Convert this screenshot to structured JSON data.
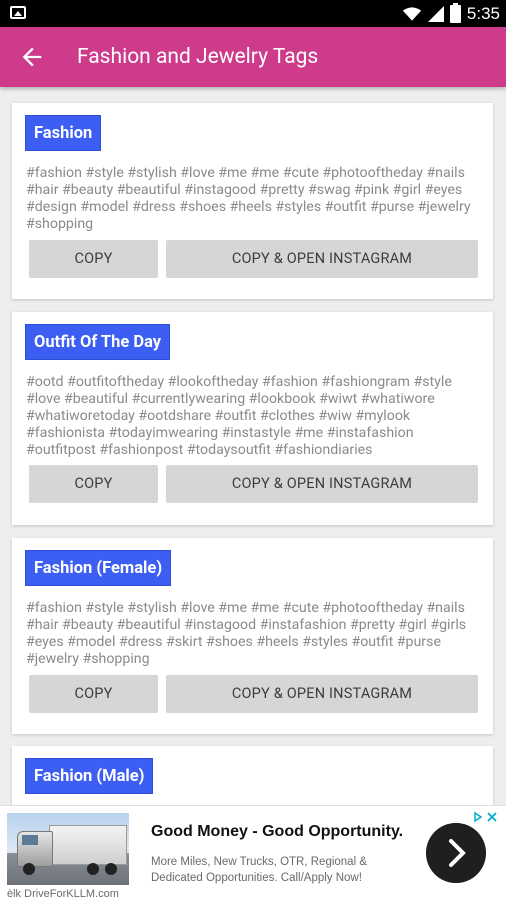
{
  "status_bar": {
    "time": "5:35"
  },
  "app_bar": {
    "title": "Fashion and Jewelry Tags"
  },
  "cards": [
    {
      "title": "Fashion",
      "tags": "#fashion #style #stylish #love #me #me #cute #photooftheday #nails #hair #beauty #beautiful #instagood #pretty #swag #pink #girl #eyes #design #model #dress #shoes #heels #styles #outfit #purse #jewelry #shopping",
      "copy_label": "COPY",
      "open_label": "COPY & OPEN INSTAGRAM"
    },
    {
      "title": "Outfit Of The Day",
      "tags": "#ootd #outfitoftheday #lookoftheday #fashion #fashiongram #style #love #beautiful #currentlywearing #lookbook #wiwt #whatiwore #whatiworetoday #ootdshare #outfit #clothes #wiw #mylook #fashionista #todayimwearing #instastyle #me #instafashion #outfitpost #fashionpost #todaysoutfit #fashiondiaries",
      "copy_label": "COPY",
      "open_label": "COPY & OPEN INSTAGRAM"
    },
    {
      "title": "Fashion (Female)",
      "tags": "#fashion #style #stylish #love #me #me #cute #photooftheday #nails #hair #beauty #beautiful #instagood #instafashion #pretty #girl #girls #eyes #model #dress #skirt #shoes #heels #styles #outfit #purse #jewelry #shopping",
      "copy_label": "COPY",
      "open_label": "COPY & OPEN INSTAGRAM"
    },
    {
      "title": "Fashion (Male)"
    }
  ],
  "ad": {
    "headline": "Good Money - Good Opportunity.",
    "body": "More Miles, New Trucks, OTR, Regional & Dedicated Opportunities. Call/Apply Now!",
    "source": "DriveForKLLM.com",
    "source_prefix": "èlk"
  },
  "colors": {
    "app_bar": "#cd3b8a",
    "card_title": "#3d5ef2",
    "button": "#d6d6d6",
    "background": "#eeeeee"
  }
}
